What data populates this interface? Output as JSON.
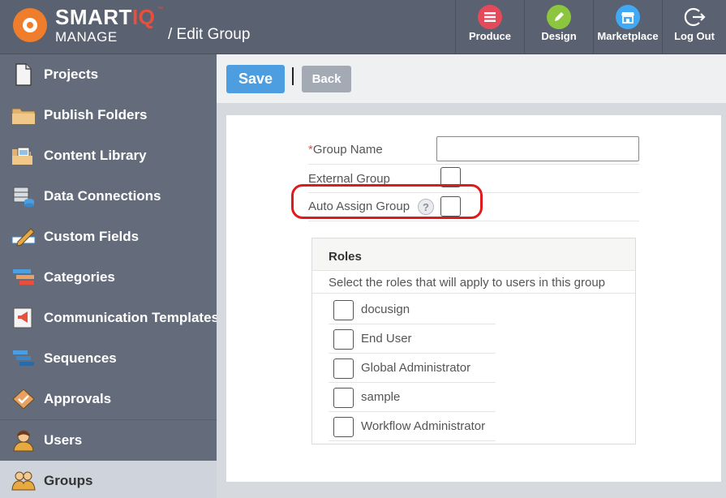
{
  "brand": {
    "smart": "SMART",
    "iq": "IQ",
    "tm": "™",
    "manage": "MANAGE"
  },
  "page_title": "/ Edit Group",
  "topnav": [
    {
      "label": "Produce",
      "icon": "produce-icon",
      "color": "#e44a5a"
    },
    {
      "label": "Design",
      "icon": "pencil-icon",
      "color": "#8cc63f"
    },
    {
      "label": "Marketplace",
      "icon": "store-icon",
      "color": "#3fa9f5"
    },
    {
      "label": "Log Out",
      "icon": "logout-icon",
      "color": ""
    }
  ],
  "sidebar": {
    "items": [
      {
        "label": "Projects",
        "icon": "document-icon"
      },
      {
        "label": "Publish Folders",
        "icon": "folder-icon"
      },
      {
        "label": "Content Library",
        "icon": "content-library-icon"
      },
      {
        "label": "Data Connections",
        "icon": "database-icon"
      },
      {
        "label": "Custom Fields",
        "icon": "pencil-field-icon"
      },
      {
        "label": "Categories",
        "icon": "categories-icon"
      },
      {
        "label": "Communication Templates",
        "icon": "megaphone-icon"
      },
      {
        "label": "Sequences",
        "icon": "sequences-icon"
      },
      {
        "label": "Approvals",
        "icon": "approval-icon"
      },
      {
        "label": "Users",
        "icon": "user-icon"
      },
      {
        "label": "Groups",
        "icon": "group-icon"
      }
    ],
    "active": "Groups"
  },
  "toolbar": {
    "save_label": "Save",
    "back_label": "Back"
  },
  "form": {
    "required_mark": "*",
    "group_name_label": "Group Name",
    "group_name_value": "",
    "external_group_label": "External Group",
    "external_group_checked": false,
    "auto_assign_label": "Auto Assign Group",
    "auto_assign_help": "?",
    "auto_assign_checked": false
  },
  "roles": {
    "title": "Roles",
    "description": "Select the roles that will apply to users in this group",
    "items": [
      {
        "label": "docusign",
        "checked": false
      },
      {
        "label": "End User",
        "checked": false
      },
      {
        "label": "Global Administrator",
        "checked": false
      },
      {
        "label": "sample",
        "checked": false
      },
      {
        "label": "Workflow Administrator",
        "checked": false
      }
    ]
  },
  "colors": {
    "accent": "#4d9ee0",
    "highlight": "#e01a1a",
    "brand_orange": "#ef7d2b"
  }
}
